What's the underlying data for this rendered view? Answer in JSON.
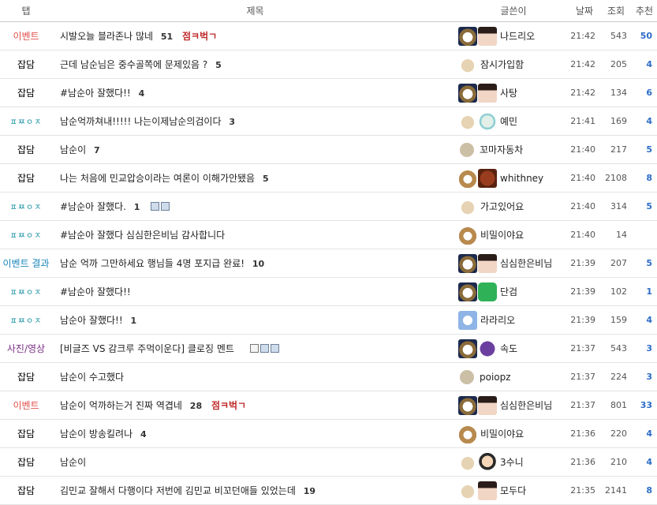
{
  "header": {
    "tab": "탭",
    "title": "제목",
    "author": "글쓴이",
    "date": "날짜",
    "views": "조회",
    "recommend": "추천"
  },
  "rows": [
    {
      "tab": "이벤트",
      "tab_class": "e",
      "title": "시발오늘 블라존나 많네",
      "comments": "51",
      "hot": "점ㅋ벅ㄱ",
      "files": [],
      "avatars": [
        "dog",
        "face"
      ],
      "author": "나드리오",
      "date": "21:42",
      "views": "543",
      "rec": "50"
    },
    {
      "tab": "잡담",
      "tab_class": "g",
      "title": "근데 남순님은 중수골쪽에 문제있음 ?",
      "comments": "5",
      "hot": "",
      "files": [],
      "avatars": [
        "tan"
      ],
      "author": "잠시가입함",
      "date": "21:42",
      "views": "205",
      "rec": "4"
    },
    {
      "tab": "잡담",
      "tab_class": "g",
      "title": "#남순아 잘했다!!",
      "comments": "4",
      "hot": "",
      "files": [],
      "avatars": [
        "dog",
        "face"
      ],
      "author": "사탕",
      "date": "21:42",
      "views": "134",
      "rec": "6"
    },
    {
      "tab": "ㅍㅉㅇㅈ",
      "tab_class": "p",
      "title": "남순억까쳐내!!!!! 나는이제남순의검이다",
      "comments": "3",
      "hot": "",
      "files": [],
      "avatars": [
        "tan",
        "sketch"
      ],
      "author": "예민",
      "date": "21:41",
      "views": "169",
      "rec": "4"
    },
    {
      "tab": "잡담",
      "tab_class": "g",
      "title": "남순이",
      "comments": "7",
      "hot": "",
      "files": [],
      "avatars": [
        "blob"
      ],
      "author": "꼬마자동차",
      "date": "21:40",
      "views": "217",
      "rec": "5"
    },
    {
      "tab": "잡담",
      "tab_class": "g",
      "title": "나는 처음에 민교압승이라는 여론이 이해가안됐음",
      "comments": "5",
      "hot": "",
      "files": [],
      "avatars": [
        "fox",
        "food"
      ],
      "author": "whithney",
      "date": "21:40",
      "views": "2108",
      "rec": "8"
    },
    {
      "tab": "ㅍㅉㅇㅈ",
      "tab_class": "p",
      "title": "#남순아 잘했다.",
      "comments": "1",
      "hot": "",
      "files": [
        "disk",
        "img"
      ],
      "avatars": [
        "tan"
      ],
      "author": "가고있어요",
      "date": "21:40",
      "views": "314",
      "rec": "5"
    },
    {
      "tab": "ㅍㅉㅇㅈ",
      "tab_class": "p",
      "title": "#남순아 잘했다 심심한은비님 감사합니다",
      "comments": "",
      "hot": "",
      "files": [],
      "avatars": [
        "fox"
      ],
      "author": "비밀이야요",
      "date": "21:40",
      "views": "14",
      "rec": ""
    },
    {
      "tab": "이벤트 결과",
      "tab_class": "r",
      "title": "남순 억까 그만하세요 행님들 4명 포지급 완료!",
      "comments": "10",
      "hot": "",
      "files": [],
      "avatars": [
        "dog",
        "face"
      ],
      "author": "심심한은비님",
      "date": "21:39",
      "views": "207",
      "rec": "5"
    },
    {
      "tab": "ㅍㅉㅇㅈ",
      "tab_class": "p",
      "title": "#남순아 잘했다!!",
      "comments": "",
      "hot": "",
      "files": [],
      "avatars": [
        "dog",
        "green"
      ],
      "author": "단검",
      "date": "21:39",
      "views": "102",
      "rec": "1"
    },
    {
      "tab": "ㅍㅉㅇㅈ",
      "tab_class": "p",
      "title": "남순아 잘했다!!",
      "comments": "1",
      "hot": "",
      "files": [],
      "avatars": [
        "blue"
      ],
      "author": "라라리오",
      "date": "21:39",
      "views": "159",
      "rec": "4"
    },
    {
      "tab": "사진/영상",
      "tab_class": "v",
      "title": "[비글즈 VS 감크루 주먹이운다] 클로징 멘트",
      "comments": "",
      "hot": "",
      "files": [
        "play",
        "disk",
        "img"
      ],
      "avatars": [
        "dog",
        "purple"
      ],
      "author": "속도",
      "date": "21:37",
      "views": "543",
      "rec": "3"
    },
    {
      "tab": "잡담",
      "tab_class": "g",
      "title": "남순이 수고했다",
      "comments": "",
      "hot": "",
      "files": [],
      "avatars": [
        "blob"
      ],
      "author": "poiopz",
      "date": "21:37",
      "views": "224",
      "rec": "3"
    },
    {
      "tab": "이벤트",
      "tab_class": "e",
      "title": "남순이 억까하는거 진짜 역겹네",
      "comments": "28",
      "hot": "점ㅋ벅ㄱ",
      "files": [],
      "avatars": [
        "dog",
        "face"
      ],
      "author": "심심한은비님",
      "date": "21:37",
      "views": "801",
      "rec": "33"
    },
    {
      "tab": "잡담",
      "tab_class": "g",
      "title": "남순이 방송킬려나",
      "comments": "4",
      "hot": "",
      "files": [],
      "avatars": [
        "fox"
      ],
      "author": "비밀이야요",
      "date": "21:36",
      "views": "220",
      "rec": "4"
    },
    {
      "tab": "잡담",
      "tab_class": "g",
      "title": "남순이",
      "comments": "",
      "hot": "",
      "files": [],
      "avatars": [
        "tan",
        "toon"
      ],
      "author": "3수니",
      "date": "21:36",
      "views": "210",
      "rec": "4"
    },
    {
      "tab": "잡담",
      "tab_class": "g",
      "title": "김민교 잘해서 다행이다 저번에 김민교 비꼬던애들 있었는데",
      "comments": "19",
      "hot": "",
      "files": [],
      "avatars": [
        "tan",
        "face"
      ],
      "author": "모두다",
      "date": "21:35",
      "views": "2141",
      "rec": "8"
    }
  ]
}
